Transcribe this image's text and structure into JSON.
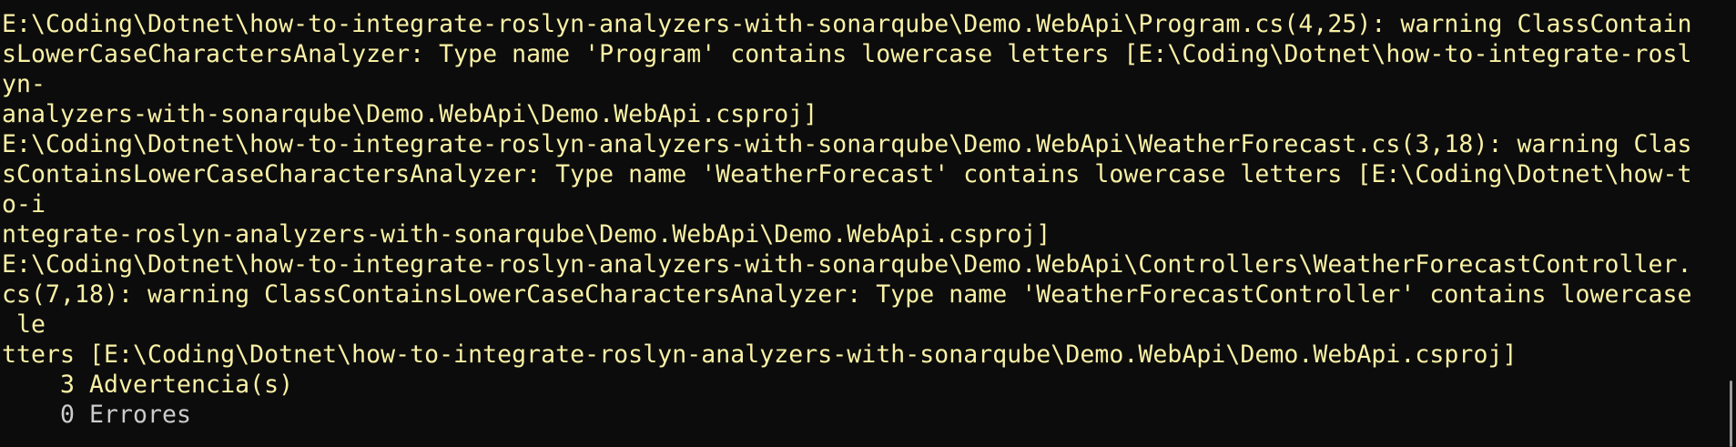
{
  "colors": {
    "background": "#0c0c0c",
    "warning_text": "#f9f1a5",
    "normal_text": "#cccccc"
  },
  "lines": [
    "E:\\Coding\\Dotnet\\how-to-integrate-roslyn-analyzers-with-sonarqube\\Demo.WebApi\\Program.cs(4,25): warning ClassContain",
    "sLowerCaseCharactersAnalyzer: Type name 'Program' contains lowercase letters [E:\\Coding\\Dotnet\\how-to-integrate-rosl",
    "yn-",
    "analyzers-with-sonarqube\\Demo.WebApi\\Demo.WebApi.csproj]",
    "E:\\Coding\\Dotnet\\how-to-integrate-roslyn-analyzers-with-sonarqube\\Demo.WebApi\\WeatherForecast.cs(3,18): warning Clas",
    "sContainsLowerCaseCharactersAnalyzer: Type name 'WeatherForecast' contains lowercase letters [E:\\Coding\\Dotnet\\how-t",
    "o-i",
    "ntegrate-roslyn-analyzers-with-sonarqube\\Demo.WebApi\\Demo.WebApi.csproj]",
    "E:\\Coding\\Dotnet\\how-to-integrate-roslyn-analyzers-with-sonarqube\\Demo.WebApi\\Controllers\\WeatherForecastController.",
    "cs(7,18): warning ClassContainsLowerCaseCharactersAnalyzer: Type name 'WeatherForecastController' contains lowercase",
    " le",
    "tters [E:\\Coding\\Dotnet\\how-to-integrate-roslyn-analyzers-with-sonarqube\\Demo.WebApi\\Demo.WebApi.csproj]"
  ],
  "summary": {
    "warnings": "    3 Advertencia(s)",
    "errors": "    0 Errores"
  }
}
